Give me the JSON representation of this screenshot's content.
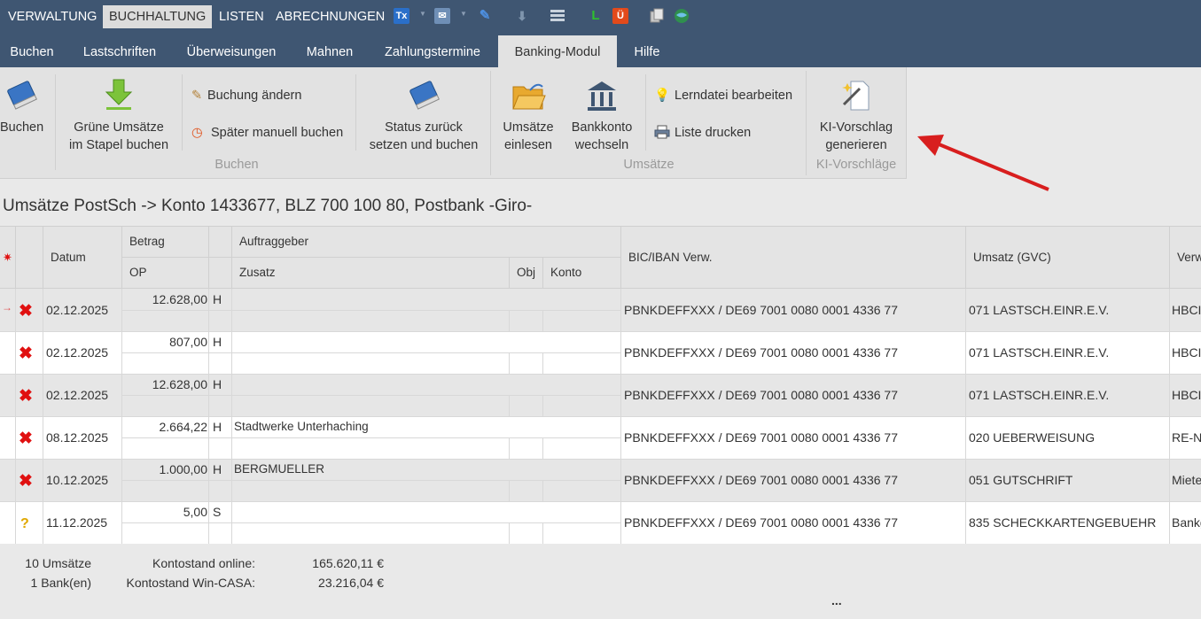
{
  "menu": {
    "items": [
      {
        "label": "VERWALTUNG"
      },
      {
        "label": "BUCHHALTUNG"
      },
      {
        "label": "LISTEN"
      },
      {
        "label": "ABRECHNUNGEN"
      }
    ],
    "icons": {
      "tx": "Tx",
      "l": "L",
      "u": "Ü"
    }
  },
  "tabs": [
    {
      "label": "Buchen"
    },
    {
      "label": "Lastschriften"
    },
    {
      "label": "Überweisungen"
    },
    {
      "label": "Mahnen"
    },
    {
      "label": "Zahlungstermine"
    },
    {
      "label": "Banking-Modul"
    },
    {
      "label": "Hilfe"
    }
  ],
  "ribbon": {
    "buchen": "Buchen",
    "gruene_1": "Grüne Umsätze",
    "gruene_2": "im Stapel buchen",
    "buchung_aendern": "Buchung ändern",
    "spaeter": "Später manuell buchen",
    "status_1": "Status zurück",
    "status_2": "setzen und buchen",
    "group_buchen": "Buchen",
    "umsaetze_1": "Umsätze",
    "umsaetze_2": "einlesen",
    "bank_1": "Bankkonto",
    "bank_2": "wechseln",
    "lerndatei": "Lerndatei bearbeiten",
    "liste": "Liste drucken",
    "group_umsaetze": "Umsätze",
    "ki_1": "KI-Vorschlag",
    "ki_2": "generieren",
    "group_ki": "KI-Vorschläge"
  },
  "title": "Umsätze PostSch -> Konto 1433677, BLZ 700 100 80, Postbank -Giro-",
  "columns": {
    "datum": "Datum",
    "betrag": "Betrag",
    "op": "OP",
    "auftraggeber": "Auftraggeber",
    "zusatz": "Zusatz",
    "obj": "Obj",
    "konto": "Konto",
    "bic": "BIC/IBAN Verw.",
    "umsatz": "Umsatz (GVC)",
    "verw": "Verw"
  },
  "rows": [
    {
      "status": "x",
      "datum": "02.12.2025",
      "betrag": "12.628,00",
      "hs": "H",
      "auftraggeber": "",
      "bic": "PBNKDEFFXXX / DE69 7001 0080 0001 4336 77",
      "umsatz": "071 LASTSCH.EINR.E.V.",
      "verw": "HBCI-"
    },
    {
      "status": "x",
      "datum": "02.12.2025",
      "betrag": "807,00",
      "hs": "H",
      "auftraggeber": "",
      "bic": "PBNKDEFFXXX / DE69 7001 0080 0001 4336 77",
      "umsatz": "071 LASTSCH.EINR.E.V.",
      "verw": "HBCI-"
    },
    {
      "status": "x",
      "datum": "02.12.2025",
      "betrag": "12.628,00",
      "hs": "H",
      "auftraggeber": "",
      "bic": "PBNKDEFFXXX / DE69 7001 0080 0001 4336 77",
      "umsatz": "071 LASTSCH.EINR.E.V.",
      "verw": "HBCI-"
    },
    {
      "status": "x",
      "datum": "08.12.2025",
      "betrag": "2.664,22",
      "hs": "H",
      "auftraggeber": "Stadtwerke Unterhaching",
      "bic": "PBNKDEFFXXX / DE69 7001 0080 0001 4336 77",
      "umsatz": "020 UEBERWEISUNG",
      "verw": "RE-Nr"
    },
    {
      "status": "x",
      "datum": "10.12.2025",
      "betrag": "1.000,00",
      "hs": "H",
      "auftraggeber": "BERGMUELLER",
      "bic": "PBNKDEFFXXX / DE69 7001 0080 0001 4336 77",
      "umsatz": "051 GUTSCHRIFT",
      "verw": "Miete"
    },
    {
      "status": "?",
      "datum": "11.12.2025",
      "betrag": "5,00",
      "hs": "S",
      "auftraggeber": "",
      "bic": "PBNKDEFFXXX / DE69 7001 0080 0001 4336 77",
      "umsatz": "835 SCHECKKARTENGEBUEHR",
      "verw": "Bankg"
    }
  ],
  "summary": {
    "count": "10 Umsätze",
    "banks": "1 Bank(en)",
    "online_label": "Kontostand online:",
    "wincasa_label": "Kontostand Win-CASA:",
    "online_value": "165.620,11 €",
    "wincasa_value": "23.216,04 €",
    "more": "..."
  },
  "icons": {
    "buchen": "book-icon",
    "gruene": "download-arrow-icon",
    "buchung_aendern": "edit-pencil-icon",
    "spaeter": "clock-icon",
    "status": "book-reset-icon",
    "umsaetze": "folder-open-icon",
    "bank": "bank-building-icon",
    "lerndatei": "lightbulb-icon",
    "liste": "printer-icon",
    "ki": "magic-wand-icon",
    "annotation": "red-arrow-icon"
  },
  "colors": {
    "topbar": "#3f5672",
    "ribbon": "#e2e2e2",
    "error": "#e01010",
    "warning": "#e0a800",
    "annotation": "#d81e1e"
  }
}
